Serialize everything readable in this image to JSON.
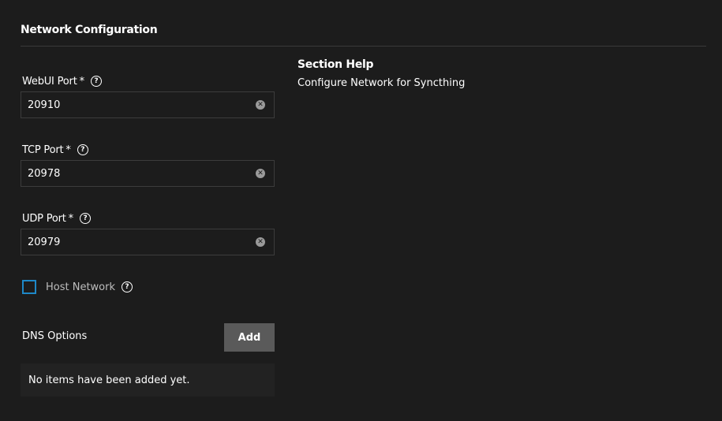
{
  "section": {
    "title": "Network Configuration"
  },
  "fields": {
    "webui_port": {
      "label": "WebUI Port",
      "required_mark": "*",
      "value": "20910",
      "icons": {
        "help": "help-circle-icon",
        "clear": "clear-circle-icon"
      }
    },
    "tcp_port": {
      "label": "TCP Port",
      "required_mark": "*",
      "value": "20978",
      "icons": {
        "help": "help-circle-icon",
        "clear": "clear-circle-icon"
      }
    },
    "udp_port": {
      "label": "UDP Port",
      "required_mark": "*",
      "value": "20979",
      "icons": {
        "help": "help-circle-icon",
        "clear": "clear-circle-icon"
      }
    }
  },
  "host_network": {
    "label": "Host Network",
    "checked": false
  },
  "dns_options": {
    "label": "DNS Options",
    "add_label": "Add",
    "empty_message": "No items have been added yet."
  },
  "help": {
    "title": "Section Help",
    "text": "Configure Network for Syncthing"
  },
  "colors": {
    "background": "#1c1c1c",
    "checkbox_border": "#1e88c7",
    "add_button": "#5a5a5a"
  }
}
